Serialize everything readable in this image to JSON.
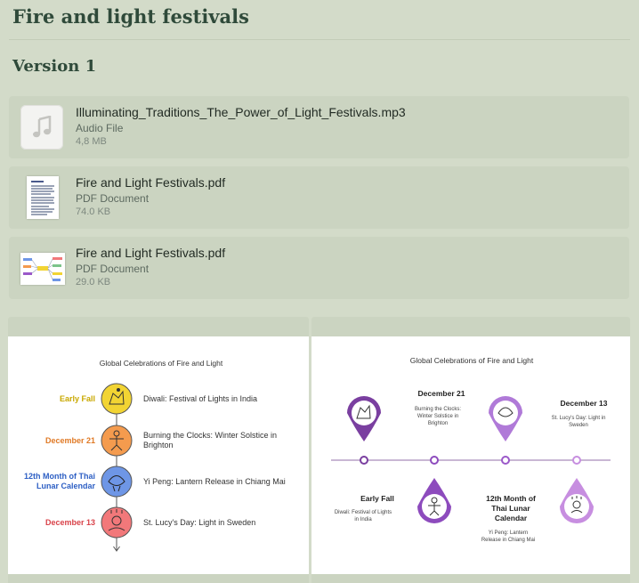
{
  "page": {
    "title": "Fire and light festivals",
    "version": "Version 1"
  },
  "files": [
    {
      "name": "Illuminating_Traditions_The_Power_of_Light_Festivals.mp3",
      "type": "Audio File",
      "size": "4,8 MB",
      "icon": "music-note-icon"
    },
    {
      "name": "Fire and Light Festivals.pdf",
      "type": "PDF Document",
      "size": "74.0 KB",
      "icon": "pdf-document-icon"
    },
    {
      "name": "Fire and Light Festivals.pdf",
      "type": "PDF Document",
      "size": "29.0 KB",
      "icon": "mindmap-thumbnail-icon"
    }
  ],
  "infographic_vertical": {
    "title": "Global Celebrations of Fire and Light",
    "items": [
      {
        "date": "Early Fall",
        "desc": "Diwali: Festival of Lights in India",
        "color": "#f2d433",
        "date_color": "#c9a800"
      },
      {
        "date": "December 21",
        "desc": "Burning the Clocks: Winter Solstice in Brighton",
        "color": "#f49b4e",
        "date_color": "#e07a26"
      },
      {
        "date": "12th Month of Thai Lunar Calendar",
        "date_line1": "12th Month of Thai",
        "date_line2": "Lunar Calendar",
        "desc": "Yi Peng: Lantern Release in Chiang Mai",
        "color": "#6e96e6",
        "date_color": "#2d5fc4"
      },
      {
        "date": "December 13",
        "desc": "St. Lucy's Day: Light in Sweden",
        "color": "#f2787a",
        "date_color": "#d9434a"
      }
    ],
    "desc_line2_item2": "Brighton",
    "desc_line1_item2": "Burning the Clocks: Winter Solstice in"
  },
  "infographic_timeline": {
    "title": "Global Celebrations of Fire and Light",
    "top": [
      {
        "date": "December 21",
        "desc_lines": [
          "Burning the Clocks:",
          "Winter Solstice in",
          "Brighton"
        ]
      },
      {
        "date": "December 13",
        "desc_lines": [
          "St. Lucy's Day: Light in",
          "Sweden"
        ]
      }
    ],
    "bottom": [
      {
        "date": "Early Fall",
        "desc_lines": [
          "Diwali: Festival of Lights",
          "in India"
        ]
      },
      {
        "date_lines": [
          "12th Month of",
          "Thai Lunar",
          "Calendar"
        ],
        "desc_lines": [
          "Yi Peng: Lantern",
          "Release in Chiang Mai"
        ]
      }
    ],
    "colors": {
      "dark_purple": "#7a3fa0",
      "mid_purple": "#9b59c9",
      "light_purple": "#c78ee0",
      "line": "#c9b7d4"
    }
  }
}
